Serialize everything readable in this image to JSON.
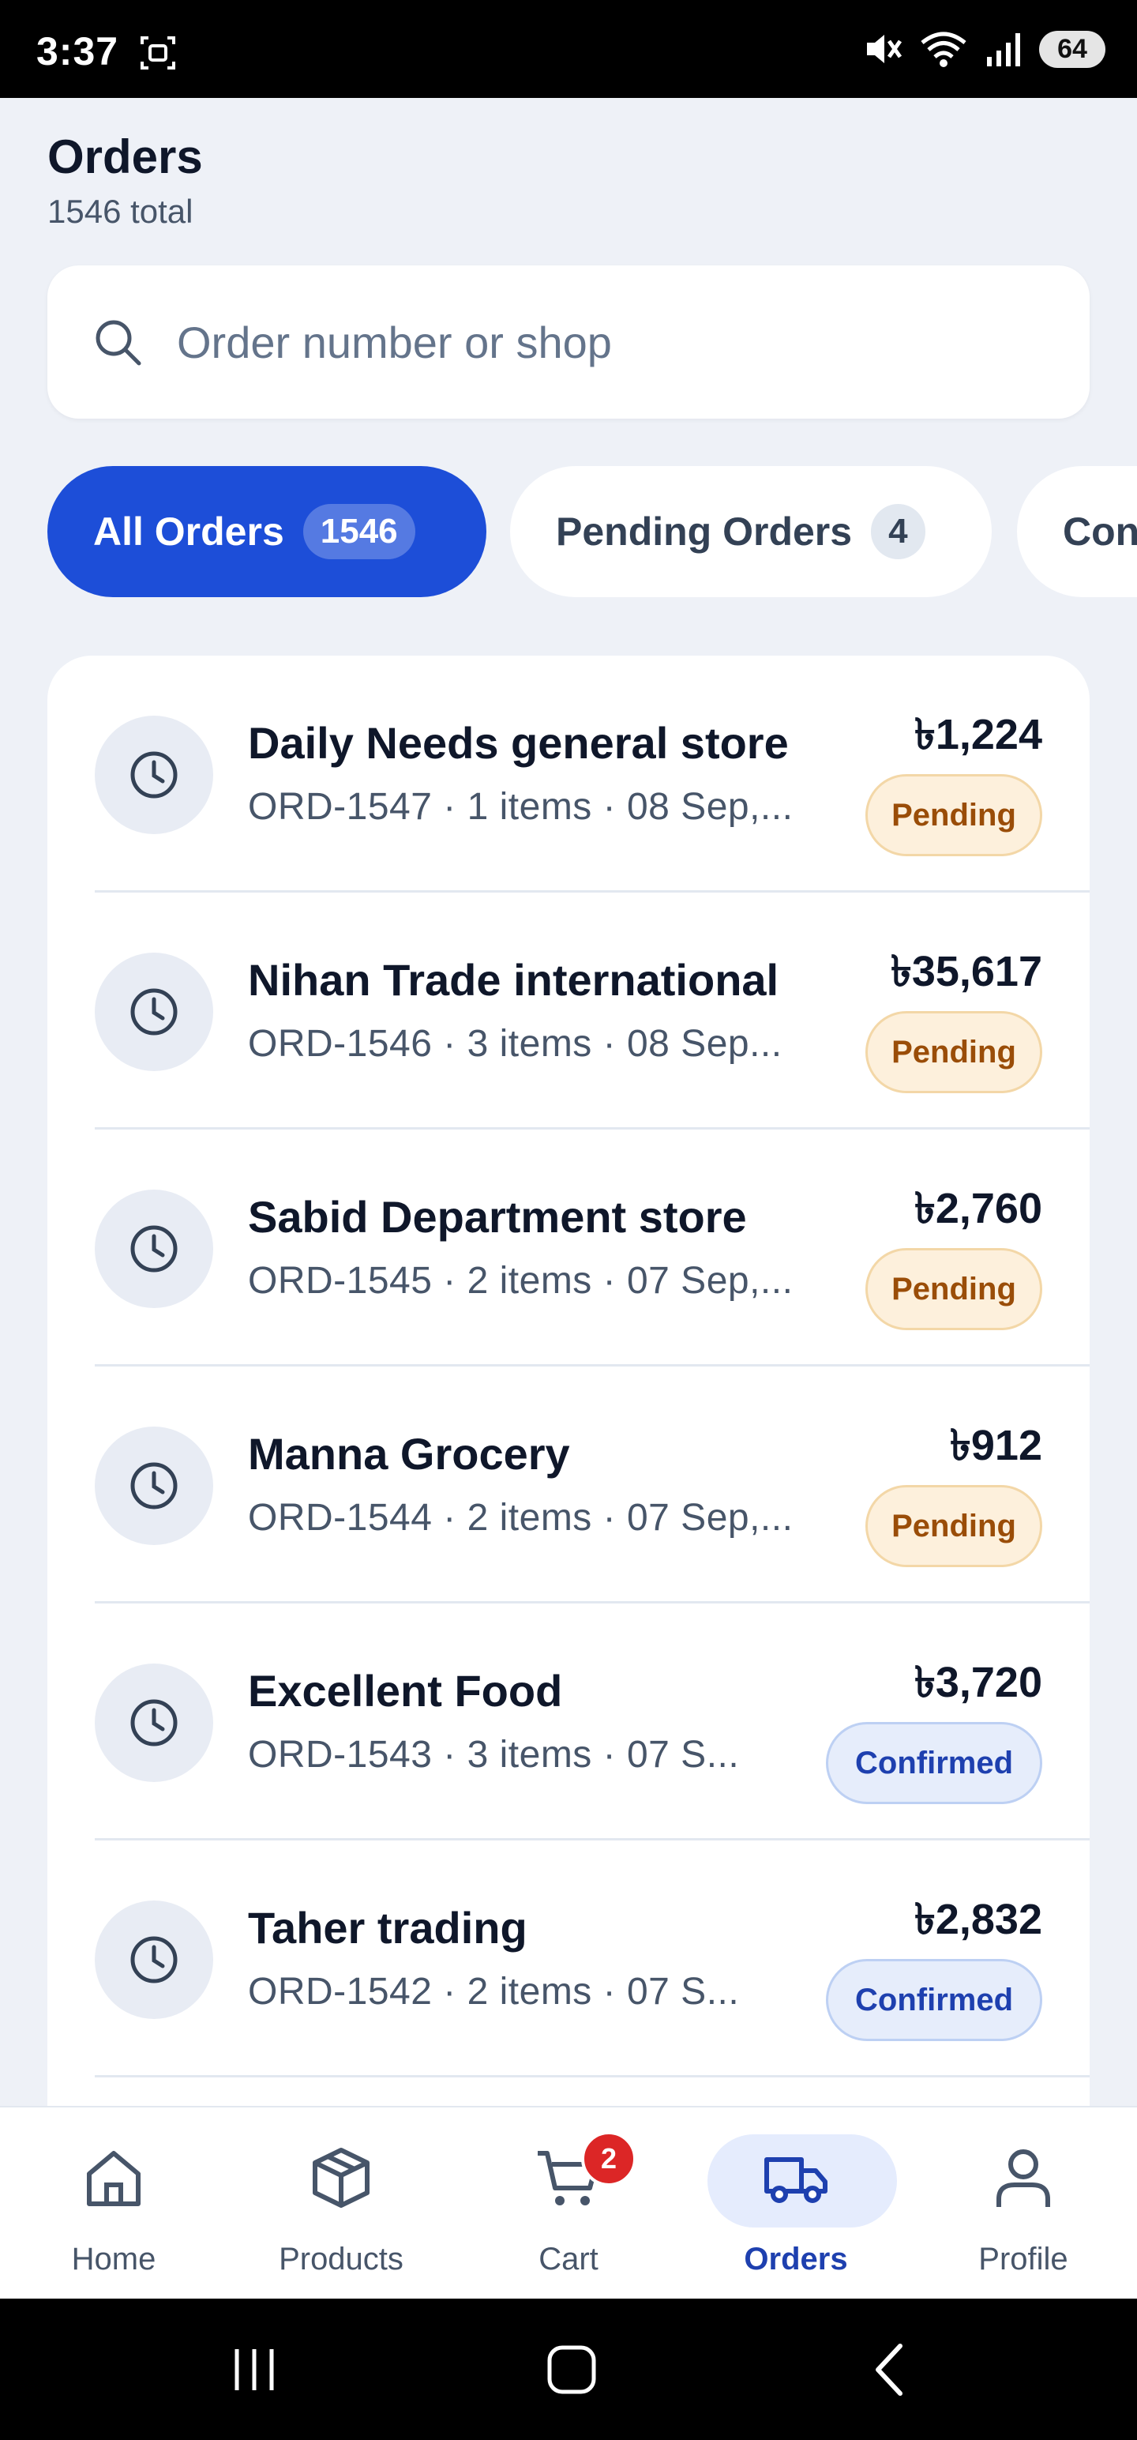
{
  "status_bar": {
    "time": "3:37",
    "battery": "64",
    "icons": [
      "screenshot-icon",
      "mute-icon",
      "wifi-icon",
      "signal-icon",
      "battery-icon"
    ]
  },
  "header": {
    "title": "Orders",
    "subtitle": "1546 total"
  },
  "search": {
    "placeholder": "Order number or shop",
    "value": ""
  },
  "tabs": [
    {
      "label": "All Orders",
      "count": "1546",
      "active": true
    },
    {
      "label": "Pending Orders",
      "count": "4",
      "active": false
    },
    {
      "label": "Confirmed",
      "count": "",
      "active": false
    }
  ],
  "orders": [
    {
      "shop": "Daily Needs general store",
      "meta": "ORD-1547 · 1 items · 08 Sep,...",
      "amount": "৳1,224",
      "status": "Pending"
    },
    {
      "shop": "Nihan Trade international",
      "meta": "ORD-1546 · 3 items · 08 Sep...",
      "amount": "৳35,617",
      "status": "Pending"
    },
    {
      "shop": "Sabid Department store",
      "meta": "ORD-1545 · 2 items · 07 Sep,...",
      "amount": "৳2,760",
      "status": "Pending"
    },
    {
      "shop": "Manna Grocery",
      "meta": "ORD-1544 · 2 items · 07 Sep,...",
      "amount": "৳912",
      "status": "Pending"
    },
    {
      "shop": "Excellent Food",
      "meta": "ORD-1543 · 3 items · 07 S...",
      "amount": "৳3,720",
      "status": "Confirmed"
    },
    {
      "shop": "Taher trading",
      "meta": "ORD-1542 · 2 items · 07 S...",
      "amount": "৳2,832",
      "status": "Confirmed"
    }
  ],
  "bottom_nav": [
    {
      "label": "Home",
      "icon": "home-icon"
    },
    {
      "label": "Products",
      "icon": "box-icon"
    },
    {
      "label": "Cart",
      "icon": "cart-icon",
      "badge": "2"
    },
    {
      "label": "Orders",
      "icon": "truck-icon",
      "active": true
    },
    {
      "label": "Profile",
      "icon": "user-icon"
    }
  ],
  "colors": {
    "primary": "#1d4ed8",
    "background": "#eef1f7",
    "pending_bg": "#fdf0dc",
    "pending_text": "#9a4d08",
    "confirmed_bg": "#e6edfb",
    "confirmed_text": "#1e40af",
    "cart_badge": "#dc2626"
  }
}
